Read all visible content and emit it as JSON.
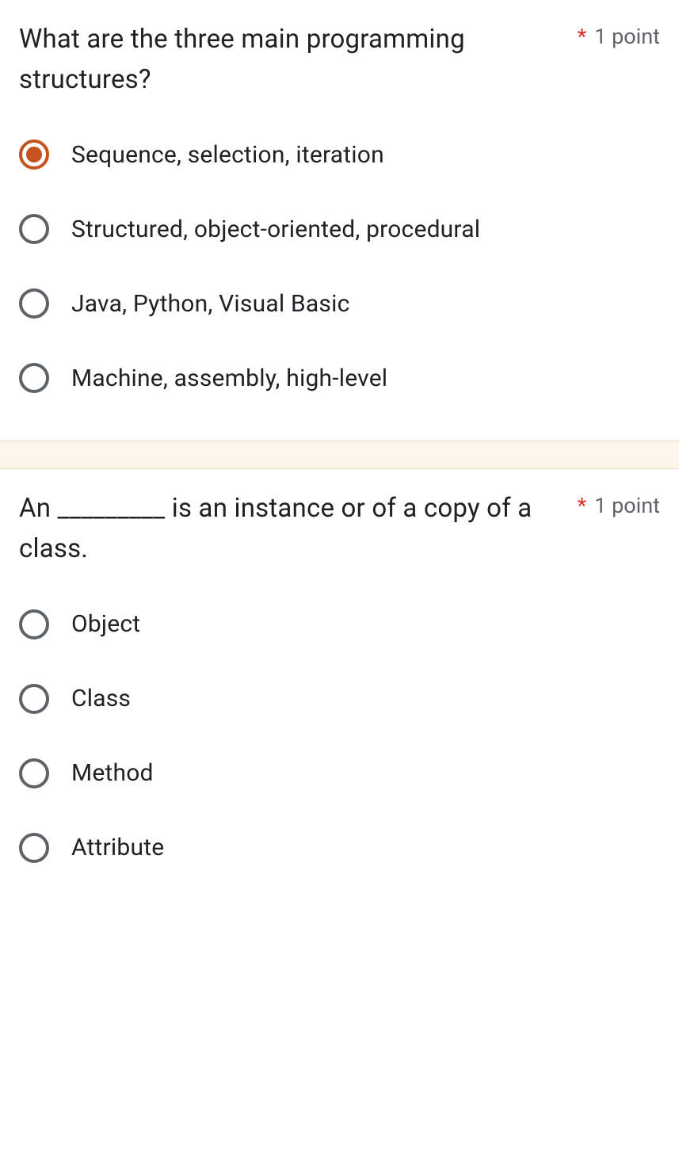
{
  "questions": [
    {
      "text": "What are the three main programming structures?",
      "required_marker": "*",
      "points": "1 point",
      "options": [
        {
          "label": "Sequence, selection, iteration",
          "selected": true
        },
        {
          "label": "Structured, object-oriented, procedural",
          "selected": false
        },
        {
          "label": "Java, Python, Visual Basic",
          "selected": false
        },
        {
          "label": "Machine, assembly, high-level",
          "selected": false
        }
      ]
    },
    {
      "text": "An _________ is an instance or of a copy of a class.",
      "required_marker": "*",
      "points": "1 point",
      "options": [
        {
          "label": "Object",
          "selected": false
        },
        {
          "label": "Class",
          "selected": false
        },
        {
          "label": "Method",
          "selected": false
        },
        {
          "label": "Attribute",
          "selected": false
        }
      ]
    }
  ]
}
